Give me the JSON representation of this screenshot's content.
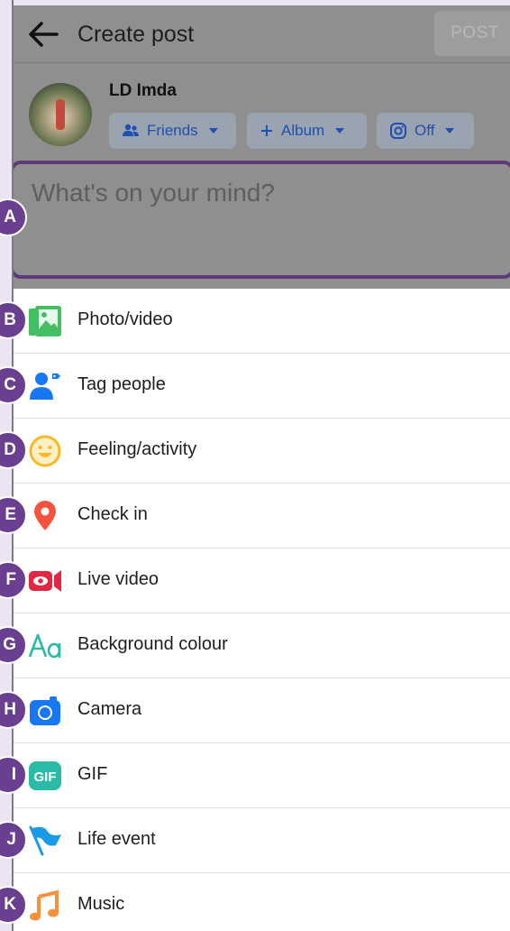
{
  "header": {
    "title": "Create post",
    "post_label": "POST"
  },
  "profile": {
    "name": "LD Imda",
    "audience": "Friends",
    "album": "Album",
    "instagram": "Off"
  },
  "composer": {
    "placeholder": "What's on your mind?"
  },
  "options": [
    {
      "label": "Photo/video",
      "icon": "photo-video-icon",
      "marker": "B"
    },
    {
      "label": "Tag people",
      "icon": "tag-people-icon",
      "marker": "C"
    },
    {
      "label": "Feeling/activity",
      "icon": "feeling-smiley-icon",
      "marker": "D"
    },
    {
      "label": "Check in",
      "icon": "location-pin-icon",
      "marker": "E"
    },
    {
      "label": "Live video",
      "icon": "live-video-icon",
      "marker": "F"
    },
    {
      "label": "Background colour",
      "icon": "background-text-icon",
      "marker": "G"
    },
    {
      "label": "Camera",
      "icon": "camera-icon",
      "marker": "H"
    },
    {
      "label": "GIF",
      "icon": "gif-icon",
      "marker": "I"
    },
    {
      "label": "Life event",
      "icon": "life-event-flag-icon",
      "marker": "J"
    },
    {
      "label": "Music",
      "icon": "music-note-icon",
      "marker": "K"
    }
  ],
  "markers": {
    "composer": "A"
  },
  "colors": {
    "accent_purple": "#6a3f8f",
    "link_blue": "#1f4fb0",
    "photo_green": "#45bd62",
    "tag_blue": "#1877f2",
    "feeling_yellow": "#f7b928",
    "checkin_red": "#f5533d",
    "live_red": "#e42645",
    "bg_teal": "#2abba7",
    "gif_teal": "#2abba7",
    "music_orange": "#f7923b"
  }
}
